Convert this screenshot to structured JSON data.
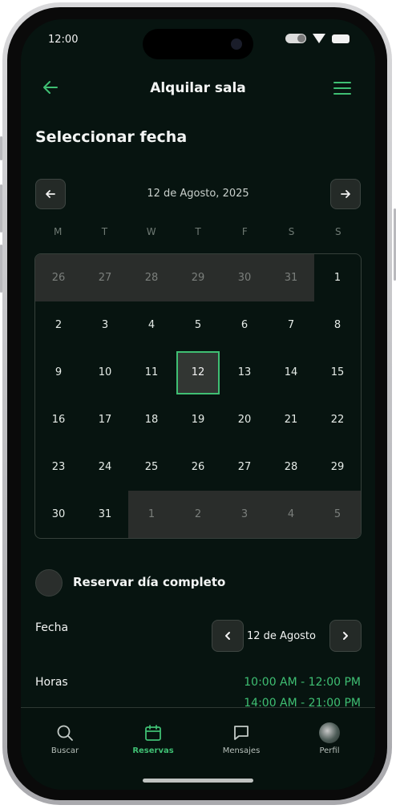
{
  "status": {
    "time": "12:00"
  },
  "header": {
    "title": "Alquilar sala",
    "back_icon": "arrow-left-icon",
    "menu_icon": "hamburger-menu-icon"
  },
  "section_title": "Seleccionar fecha",
  "calendar": {
    "month_label": "12 de Agosto, 2025",
    "weekdays": [
      "M",
      "T",
      "W",
      "T",
      "F",
      "S",
      "S"
    ],
    "days": [
      {
        "d": "26",
        "out": true
      },
      {
        "d": "27",
        "out": true
      },
      {
        "d": "28",
        "out": true
      },
      {
        "d": "29",
        "out": true
      },
      {
        "d": "30",
        "out": true
      },
      {
        "d": "31",
        "out": true
      },
      {
        "d": "1",
        "out": false
      },
      {
        "d": "2",
        "out": false
      },
      {
        "d": "3",
        "out": false
      },
      {
        "d": "4",
        "out": false
      },
      {
        "d": "5",
        "out": false
      },
      {
        "d": "6",
        "out": false
      },
      {
        "d": "7",
        "out": false
      },
      {
        "d": "8",
        "out": false
      },
      {
        "d": "9",
        "out": false
      },
      {
        "d": "10",
        "out": false
      },
      {
        "d": "11",
        "out": false
      },
      {
        "d": "12",
        "out": false,
        "selected": true
      },
      {
        "d": "13",
        "out": false
      },
      {
        "d": "14",
        "out": false
      },
      {
        "d": "15",
        "out": false
      },
      {
        "d": "16",
        "out": false
      },
      {
        "d": "17",
        "out": false
      },
      {
        "d": "18",
        "out": false
      },
      {
        "d": "19",
        "out": false
      },
      {
        "d": "20",
        "out": false
      },
      {
        "d": "21",
        "out": false
      },
      {
        "d": "22",
        "out": false
      },
      {
        "d": "23",
        "out": false
      },
      {
        "d": "24",
        "out": false
      },
      {
        "d": "25",
        "out": false
      },
      {
        "d": "26",
        "out": false
      },
      {
        "d": "27",
        "out": false
      },
      {
        "d": "28",
        "out": false
      },
      {
        "d": "29",
        "out": false
      },
      {
        "d": "30",
        "out": false
      },
      {
        "d": "31",
        "out": false
      },
      {
        "d": "1",
        "out": true
      },
      {
        "d": "2",
        "out": true
      },
      {
        "d": "3",
        "out": true
      },
      {
        "d": "4",
        "out": true
      },
      {
        "d": "5",
        "out": true
      }
    ]
  },
  "full_day": {
    "label": "Reservar día completo"
  },
  "fecha": {
    "label": "Fecha",
    "value": "12 de Agosto"
  },
  "horas": {
    "label": "Horas",
    "slots": [
      "10:00 AM - 12:00 PM",
      "14:00 AM - 21:00 PM"
    ]
  },
  "tabs": [
    {
      "label": "Buscar",
      "icon": "search-icon"
    },
    {
      "label": "Reservas",
      "icon": "calendar-icon",
      "active": true
    },
    {
      "label": "Mensajes",
      "icon": "chat-bubble-icon"
    },
    {
      "label": "Perfil",
      "icon": "avatar"
    }
  ],
  "colors": {
    "accent": "#3fbf73",
    "background": "#071410"
  }
}
